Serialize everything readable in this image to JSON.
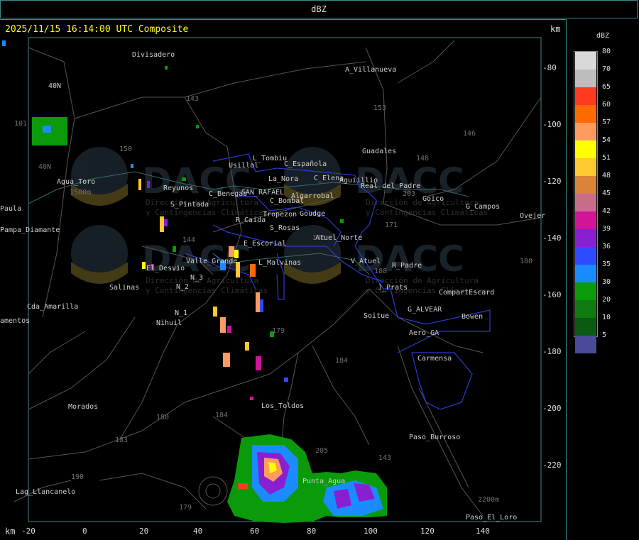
{
  "header": {
    "product": "dBZ",
    "timestamp": "2025/11/15 16:14:00 UTC Composite"
  },
  "axis": {
    "unit_top": "km",
    "unit_bottom": "km",
    "x_ticks": [
      "-20",
      "0",
      "20",
      "40",
      "60",
      "80",
      "100",
      "120",
      "140"
    ],
    "y_ticks": [
      "-80",
      "-100",
      "-120",
      "-140",
      "-160",
      "-180",
      "-200",
      "-220"
    ]
  },
  "legend": {
    "title": "dBZ",
    "items": [
      {
        "label": "80",
        "color": "#d9d9d9"
      },
      {
        "label": "70",
        "color": "#bdbdbd"
      },
      {
        "label": "65",
        "color": "#ff3b1f"
      },
      {
        "label": "60",
        "color": "#ff6a00"
      },
      {
        "label": "57",
        "color": "#ff9b5e"
      },
      {
        "label": "54",
        "color": "#ffff00"
      },
      {
        "label": "51",
        "color": "#ffc830"
      },
      {
        "label": "48",
        "color": "#d9843a"
      },
      {
        "label": "45",
        "color": "#c86c8c"
      },
      {
        "label": "42",
        "color": "#d2149a"
      },
      {
        "label": "39",
        "color": "#8a1fd2"
      },
      {
        "label": "36",
        "color": "#2f4bff"
      },
      {
        "label": "35",
        "color": "#1a8cff"
      },
      {
        "label": "30",
        "color": "#0a9a0a"
      },
      {
        "label": "20",
        "color": "#0f7a0f"
      },
      {
        "label": "10",
        "color": "#0a5a14"
      },
      {
        "label": "5",
        "color": "#4a4a9a"
      }
    ]
  },
  "watermark": {
    "brand": "DACC",
    "line1": "Dirección de Agricultura",
    "line2": "y Contingencias Climáticas"
  },
  "places": [
    {
      "name": "Divisadero"
    },
    {
      "name": "A_Villanueva"
    },
    {
      "name": "40N"
    },
    {
      "name": "Usillal"
    },
    {
      "name": "L_Tombiu"
    },
    {
      "name": "C_Española"
    },
    {
      "name": "Guadales"
    },
    {
      "name": "C_Elena"
    },
    {
      "name": "Aguiillio"
    },
    {
      "name": "Real_del_Padre"
    },
    {
      "name": "Agua_Toro"
    },
    {
      "name": "Reyunos"
    },
    {
      "name": "La_Nora"
    },
    {
      "name": "C_Benegas"
    },
    {
      "name": "SAN_RAFAEL"
    },
    {
      "name": "Algarrobal"
    },
    {
      "name": "Goico"
    },
    {
      "name": "G_Campos"
    },
    {
      "name": "Ovejer"
    },
    {
      "name": "S_Pintada"
    },
    {
      "name": "C_Bombal"
    },
    {
      "name": "Tropezon"
    },
    {
      "name": "Goudge"
    },
    {
      "name": "Paula"
    },
    {
      "name": "Pampa_Diamante"
    },
    {
      "name": "R_Caida"
    },
    {
      "name": "S_Rosas"
    },
    {
      "name": "Atuel_Norte"
    },
    {
      "name": "E_Escorial"
    },
    {
      "name": "Valle_Grande"
    },
    {
      "name": "L_Malvinas"
    },
    {
      "name": "V_Atuel"
    },
    {
      "name": "R_Padre"
    },
    {
      "name": "El_Desvio"
    },
    {
      "name": "N_3"
    },
    {
      "name": "N_2"
    },
    {
      "name": "Salinas"
    },
    {
      "name": "J_Prats"
    },
    {
      "name": "CompartEscard"
    },
    {
      "name": "Cda_Amarilla"
    },
    {
      "name": "amentos"
    },
    {
      "name": "N_1"
    },
    {
      "name": "Nihuil"
    },
    {
      "name": "G_ALVEAR"
    },
    {
      "name": "Soitue"
    },
    {
      "name": "Bowen"
    },
    {
      "name": "Aero_GA"
    },
    {
      "name": "Carmensa"
    },
    {
      "name": "Morados"
    },
    {
      "name": "Los_Toldos"
    },
    {
      "name": "Paso_Burroso"
    },
    {
      "name": "Punta_Agua"
    },
    {
      "name": "Lag_Llancanelo"
    },
    {
      "name": "Paso_El_Loro"
    }
  ],
  "route_labels": [
    "143",
    "153",
    "146",
    "148",
    "150",
    "101",
    "40N",
    "1500m",
    "203",
    "171",
    "144",
    "146",
    "188",
    "179",
    "184",
    "180",
    "184",
    "183",
    "190",
    "143",
    "2200m",
    "179",
    "205",
    "180"
  ]
}
